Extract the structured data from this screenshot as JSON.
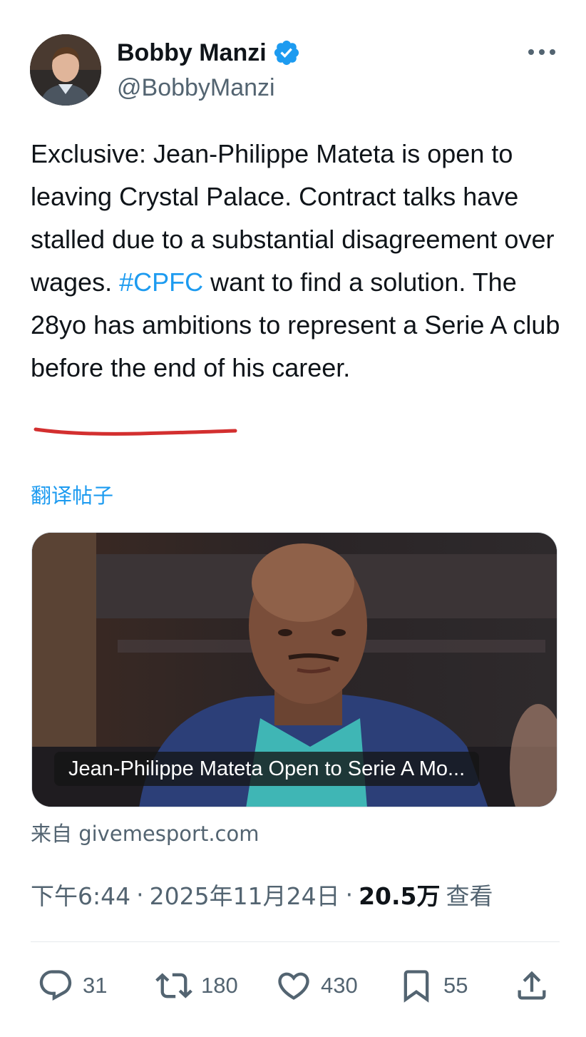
{
  "author": {
    "display_name": "Bobby Manzi",
    "handle": "@BobbyManzi",
    "verified": true
  },
  "tweet": {
    "text_before_hashtag": "Exclusive: Jean-Philippe Mateta is open to leaving Crystal Palace. Contract talks have stalled due to a substantial disagreement over wages. ",
    "hashtag": "#CPFC",
    "text_after_hashtag": " want to find a solution. The 28yo has ambitions to represent a Serie A club before the end of his career.",
    "translate_label": "翻译帖子"
  },
  "media": {
    "caption": "Jean-Philippe Mateta Open to Serie A Mo...",
    "source": "来自 givemesport.com"
  },
  "meta": {
    "time": "下午6:44",
    "separator": "·",
    "date": "2025年11月24日",
    "views_count": "20.5万",
    "views_label": "查看"
  },
  "actions": {
    "replies": "31",
    "retweets": "180",
    "likes": "430",
    "bookmarks": "55"
  },
  "icons": {
    "verified": "verified-badge-icon",
    "more": "more-icon",
    "reply": "reply-icon",
    "retweet": "retweet-icon",
    "like": "heart-icon",
    "bookmark": "bookmark-icon",
    "share": "share-icon"
  },
  "colors": {
    "accent": "#1d9bf0",
    "text": "#0f1419",
    "secondary": "#536471",
    "annotation_underline": "#d32f2f"
  }
}
